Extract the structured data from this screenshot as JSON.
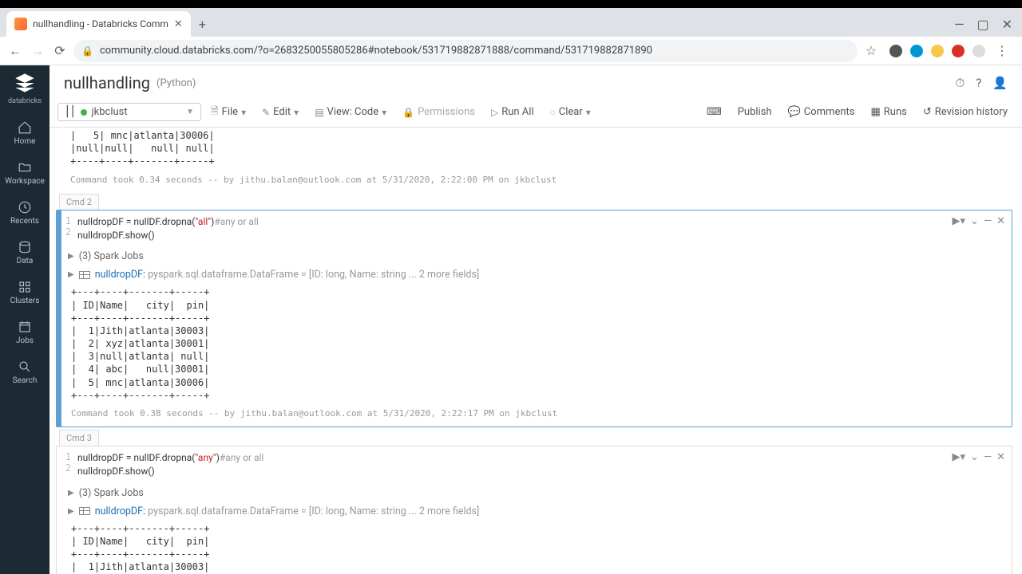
{
  "browser": {
    "tab_title": "nullhandling - Databricks Comm",
    "url": "community.cloud.databricks.com/?o=2683250055805286#notebook/531719882871888/command/531719882871890"
  },
  "sidebar": {
    "brand": "databricks",
    "items": [
      {
        "label": "Home"
      },
      {
        "label": "Workspace"
      },
      {
        "label": "Recents"
      },
      {
        "label": "Data"
      },
      {
        "label": "Clusters"
      },
      {
        "label": "Jobs"
      },
      {
        "label": "Search"
      }
    ]
  },
  "header": {
    "title": "nullhandling",
    "lang": "(Python)"
  },
  "toolbar": {
    "cluster": "jkbclust",
    "file": "File",
    "edit": "Edit",
    "view": "View: Code",
    "permissions": "Permissions",
    "run_all": "Run All",
    "clear": "Clear",
    "publish": "Publish",
    "comments": "Comments",
    "runs": "Runs",
    "revision": "Revision history"
  },
  "cells": {
    "c1_output": "|   5| mnc|atlanta|30006|\n|null|null|   null| null|\n+----+----+-------+-----+",
    "c1_meta": "Command took 0.34 seconds -- by jithu.balan@outlook.com at 5/31/2020, 2:22:00 PM on jkbclust",
    "c2_label": "Cmd 2",
    "c2_code1a": "nulldropDF = nullDF.dropna(",
    "c2_code1b": "\"all\"",
    "c2_code1c": ")",
    "c2_code1d": "#any or all",
    "c2_code2": "nulldropDF.show()",
    "c2_jobs": "(3) Spark Jobs",
    "c2_df_name": "nulldropDF: ",
    "c2_df_type": "pyspark.sql.dataframe.DataFrame = [ID: long, Name: string",
    "c2_df_more": " ... 2 more fields]",
    "c2_output": "+---+----+-------+-----+\n| ID|Name|   city|  pin|\n+---+----+-------+-----+\n|  1|Jith|atlanta|30003|\n|  2| xyz|atlanta|30001|\n|  3|null|atlanta| null|\n|  4| abc|   null|30001|\n|  5| mnc|atlanta|30006|\n+---+----+-------+-----+",
    "c2_meta": "Command took 0.38 seconds -- by jithu.balan@outlook.com at 5/31/2020, 2:22:17 PM on jkbclust",
    "c3_label": "Cmd 3",
    "c3_code1a": "nulldropDF = nullDF.dropna(",
    "c3_code1b": "\"any\"",
    "c3_code1c": ")",
    "c3_code1d": "#any or all",
    "c3_code2": "nulldropDF.show()",
    "c3_jobs": "(3) Spark Jobs",
    "c3_df_name": "nulldropDF: ",
    "c3_df_type": "pyspark.sql.dataframe.DataFrame = [ID: long, Name: string",
    "c3_df_more": " ... 2 more fields]",
    "c3_output": "+---+----+-------+-----+\n| ID|Name|   city|  pin|\n+---+----+-------+-----+\n|  1|Jith|atlanta|30003|"
  }
}
